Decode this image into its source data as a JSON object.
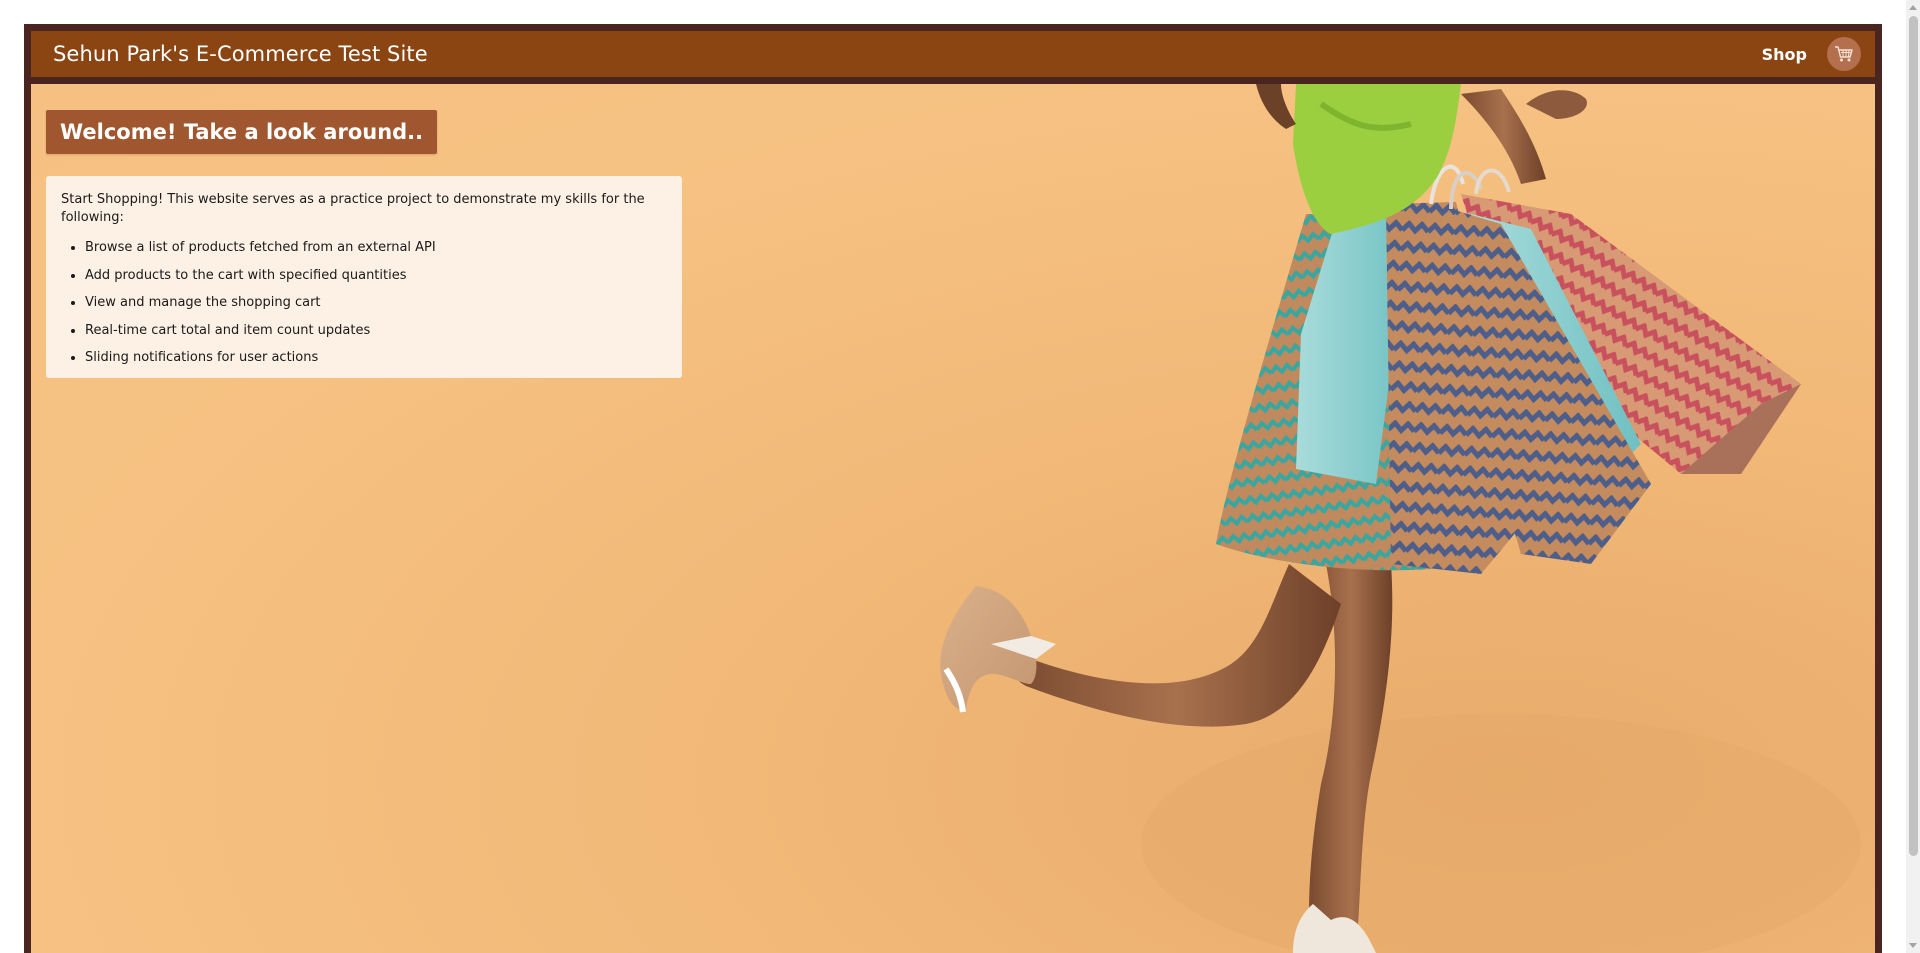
{
  "header": {
    "title": "Sehun Park's E-Commerce Test Site",
    "shop_label": "Shop",
    "cart_icon": "shopping-cart-icon"
  },
  "hero": {
    "welcome": "Welcome! Take a look around..",
    "intro": "Start Shopping! This website serves as a practice project to demonstrate my skills for the following:",
    "features": [
      "Browse a list of products fetched from an external API",
      "Add products to the cart with specified quantities",
      "View and manage the shopping cart",
      "Real-time cart total and item count updates",
      "Sliding notifications for user actions"
    ]
  },
  "colors": {
    "frame": "#4a2520",
    "navbar": "#8b4513",
    "welcome_badge": "#a0572f",
    "hero_background": "#f5c081",
    "info_card": "#fdf1e5"
  }
}
